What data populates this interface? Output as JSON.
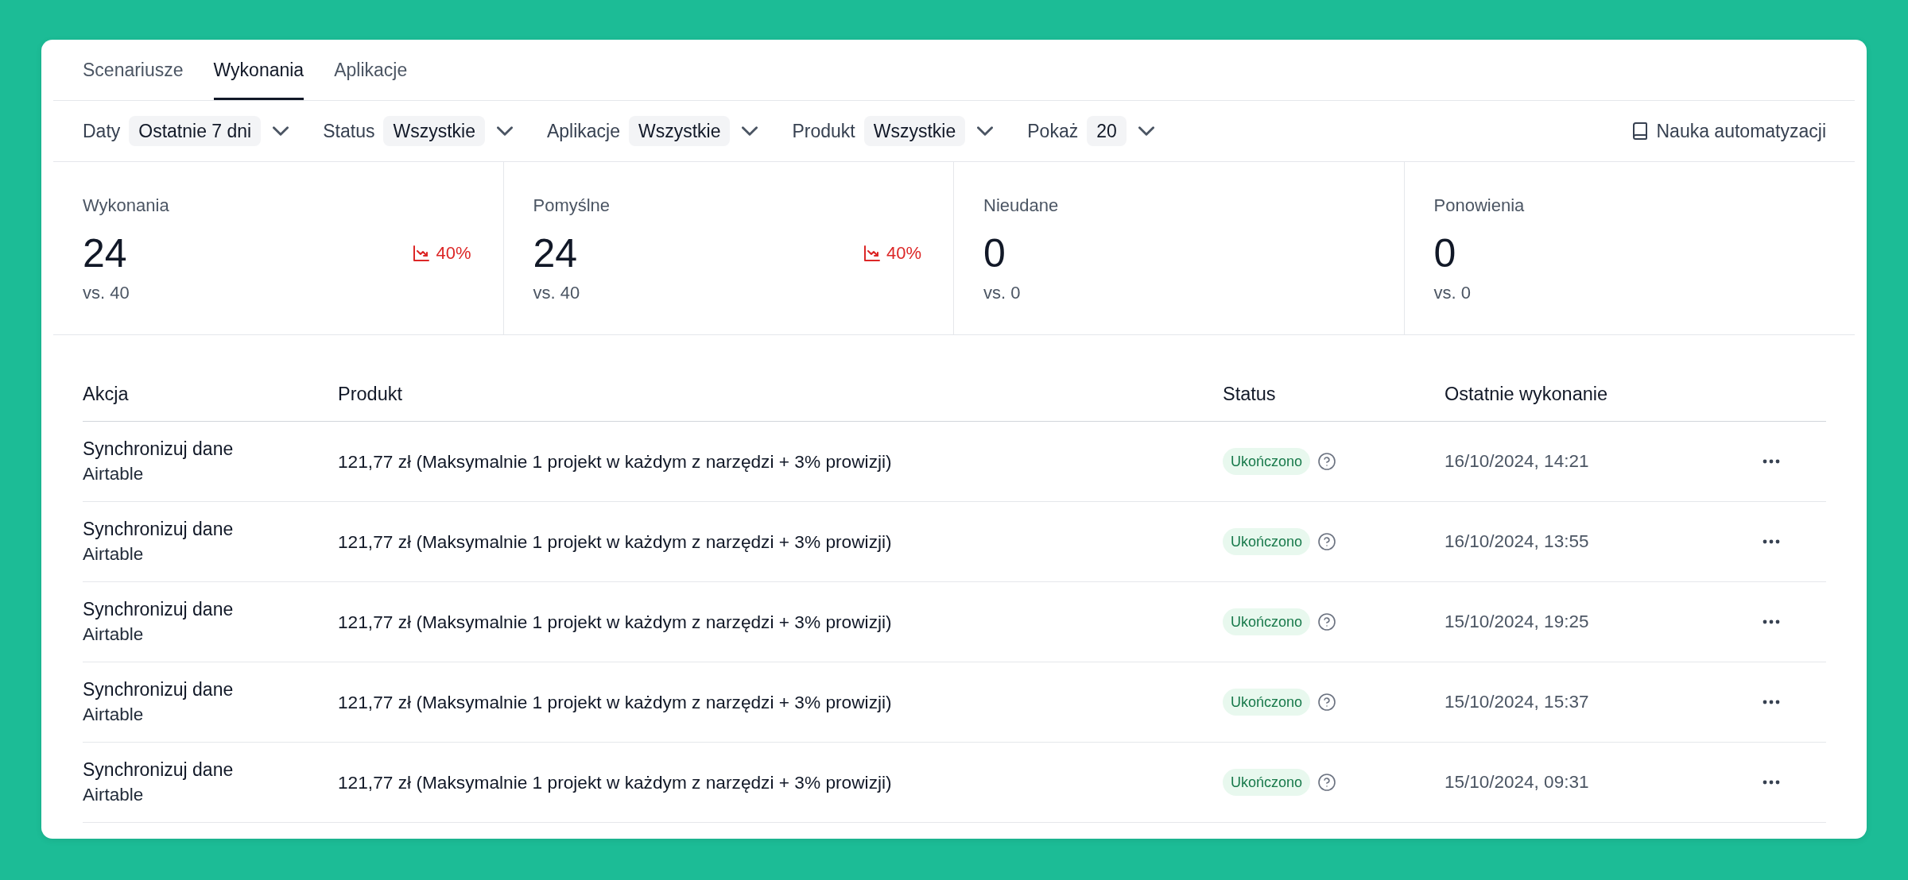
{
  "tabs": [
    {
      "label": "Scenariusze",
      "selected": false
    },
    {
      "label": "Wykonania",
      "selected": true
    },
    {
      "label": "Aplikacje",
      "selected": false
    }
  ],
  "filters": [
    {
      "label": "Daty",
      "value": "Ostatnie 7 dni"
    },
    {
      "label": "Status",
      "value": "Wszystkie"
    },
    {
      "label": "Aplikacje",
      "value": "Wszystkie"
    },
    {
      "label": "Produkt",
      "value": "Wszystkie"
    },
    {
      "label": "Pokaż",
      "value": "20"
    }
  ],
  "help_link": {
    "label": "Nauka automatyzacji"
  },
  "stats": [
    {
      "label": "Wykonania",
      "value": "24",
      "comparison": "vs. 40",
      "trend": {
        "kind": "down",
        "text": "40%"
      }
    },
    {
      "label": "Pomyślne",
      "value": "24",
      "comparison": "vs. 40",
      "trend": {
        "kind": "down",
        "text": "40%"
      }
    },
    {
      "label": "Nieudane",
      "value": "0",
      "comparison": "vs. 0"
    },
    {
      "label": "Ponowienia",
      "value": "0",
      "comparison": "vs. 0"
    }
  ],
  "table": {
    "columns": [
      "Akcja",
      "Produkt",
      "Status",
      "Ostatnie wykonanie"
    ],
    "rows": [
      {
        "action": "Synchronizuj dane",
        "app": "Airtable",
        "product": "121,77 zł (Maksymalnie 1 projekt w każdym z narzędzi + 3% prowizji)",
        "status": {
          "label": "Ukończono",
          "kind": "success"
        },
        "last_run": "16/10/2024, 14:21"
      },
      {
        "action": "Synchronizuj dane",
        "app": "Airtable",
        "product": "121,77 zł (Maksymalnie 1 projekt w każdym z narzędzi + 3% prowizji)",
        "status": {
          "label": "Ukończono",
          "kind": "success"
        },
        "last_run": "16/10/2024, 13:55"
      },
      {
        "action": "Synchronizuj dane",
        "app": "Airtable",
        "product": "121,77 zł (Maksymalnie 1 projekt w każdym z narzędzi + 3% prowizji)",
        "status": {
          "label": "Ukończono",
          "kind": "success"
        },
        "last_run": "15/10/2024, 19:25"
      },
      {
        "action": "Synchronizuj dane",
        "app": "Airtable",
        "product": "121,77 zł (Maksymalnie 1 projekt w każdym z narzędzi + 3% prowizji)",
        "status": {
          "label": "Ukończono",
          "kind": "success"
        },
        "last_run": "15/10/2024, 15:37"
      },
      {
        "action": "Synchronizuj dane",
        "app": "Airtable",
        "product": "121,77 zł (Maksymalnie 1 projekt w każdym z narzędzi + 3% prowizji)",
        "status": {
          "label": "Ukończono",
          "kind": "success"
        },
        "last_run": "15/10/2024, 09:31"
      }
    ]
  }
}
